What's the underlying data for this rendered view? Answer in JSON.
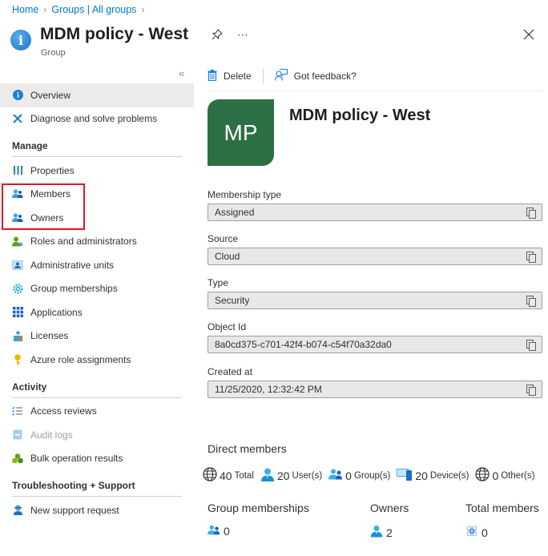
{
  "breadcrumb": [
    {
      "label": "Home"
    },
    {
      "label": "Groups | All groups"
    }
  ],
  "header": {
    "title": "MDM policy - West",
    "subtitle": "Group"
  },
  "sidebar": {
    "items_top": [
      {
        "label": "Overview",
        "icon": "info-icon",
        "active": true
      },
      {
        "label": "Diagnose and solve problems",
        "icon": "wrench-icon"
      }
    ],
    "sections": [
      {
        "title": "Manage",
        "items": [
          {
            "label": "Properties",
            "icon": "properties-icon"
          },
          {
            "label": "Members",
            "icon": "members-icon"
          },
          {
            "label": "Owners",
            "icon": "owners-icon"
          },
          {
            "label": "Roles and administrators",
            "icon": "roles-icon"
          },
          {
            "label": "Administrative units",
            "icon": "admin-units-icon"
          },
          {
            "label": "Group memberships",
            "icon": "gear-icon"
          },
          {
            "label": "Applications",
            "icon": "apps-grid-icon"
          },
          {
            "label": "Licenses",
            "icon": "licenses-icon"
          },
          {
            "label": "Azure role assignments",
            "icon": "key-icon"
          }
        ]
      },
      {
        "title": "Activity",
        "items": [
          {
            "label": "Access reviews",
            "icon": "checklist-icon"
          },
          {
            "label": "Audit logs",
            "icon": "log-icon",
            "disabled": true
          },
          {
            "label": "Bulk operation results",
            "icon": "bulk-icon"
          }
        ]
      },
      {
        "title": "Troubleshooting + Support",
        "items": [
          {
            "label": "New support request",
            "icon": "support-icon"
          }
        ]
      }
    ]
  },
  "toolbar": {
    "delete_label": "Delete",
    "feedback_label": "Got feedback?"
  },
  "entity": {
    "avatar_initials": "MP",
    "avatar_color": "#2d6f44",
    "name": "MDM policy - West"
  },
  "fields": [
    {
      "label": "Membership type",
      "value": "Assigned"
    },
    {
      "label": "Source",
      "value": "Cloud"
    },
    {
      "label": "Type",
      "value": "Security"
    },
    {
      "label": "Object Id",
      "value": "8a0cd375-c701-42f4-b074-c54f70a32da0"
    },
    {
      "label": "Created at",
      "value": "11/25/2020, 12:32:42 PM"
    }
  ],
  "direct_members": {
    "title": "Direct members",
    "items": [
      {
        "icon": "globe-icon",
        "count": "40",
        "label": "Total"
      },
      {
        "icon": "user-icon",
        "count": "20",
        "label": "User(s)"
      },
      {
        "icon": "group-icon",
        "count": "0",
        "label": "Group(s)"
      },
      {
        "icon": "device-icon",
        "count": "20",
        "label": "Device(s)"
      },
      {
        "icon": "globe-icon",
        "count": "0",
        "label": "Other(s)"
      }
    ]
  },
  "stats": [
    {
      "label": "Group memberships",
      "value": "0",
      "icon": "group-icon"
    },
    {
      "label": "Owners",
      "value": "2",
      "icon": "user-icon"
    },
    {
      "label": "Total members",
      "value": "0",
      "icon": "total-members-icon"
    }
  ]
}
